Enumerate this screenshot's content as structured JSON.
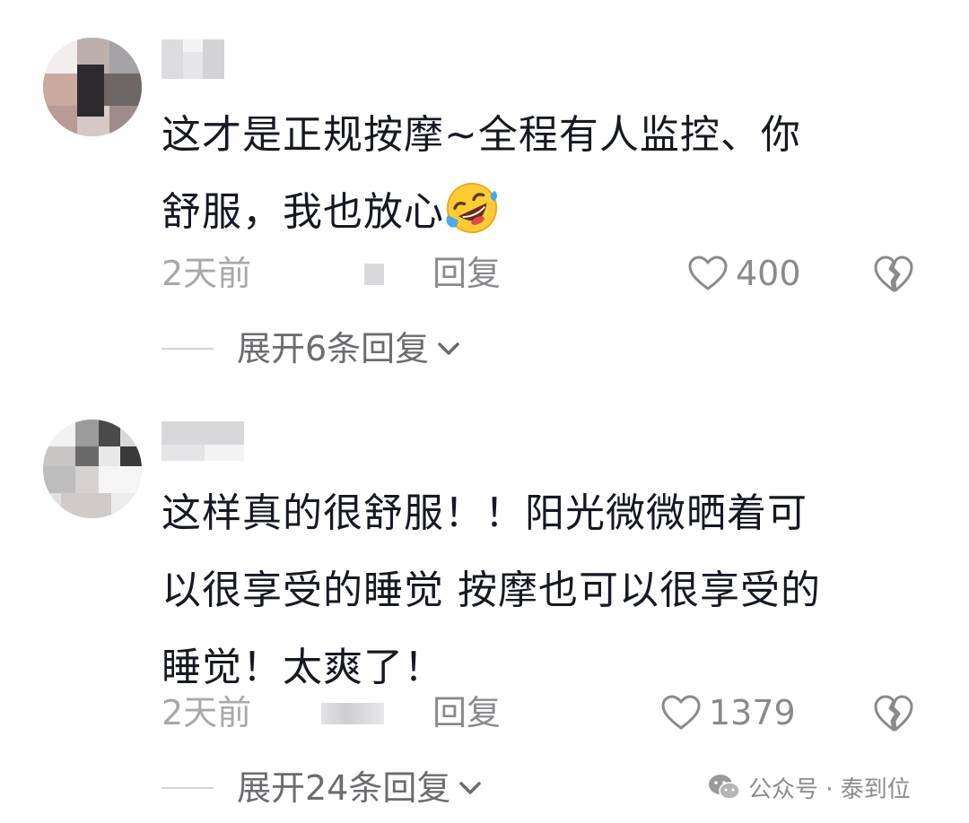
{
  "comments": [
    {
      "text_line1": "这才是正规按摩~全程有人监控、你",
      "text_line2": "舒服，我也放心",
      "emoji": "rolling-on-floor-laughing-icon",
      "time": "2天前",
      "reply_label": "回复",
      "likes": "400",
      "expand_label": "展开6条回复"
    },
    {
      "text_line1": "这样真的很舒服！！阳光微微晒着可",
      "text_line2": "以很享受的睡觉 按摩也可以很享受的",
      "text_line3": "睡觉！太爽了！",
      "time": "2天前",
      "reply_label": "回复",
      "likes": "1379",
      "expand_label": "展开24条回复"
    }
  ],
  "watermark": {
    "text": "公众号 · 泰到位"
  },
  "colors": {
    "text_primary": "#161823",
    "text_secondary": "#a8a8ab",
    "text_action": "#8a8a8e"
  }
}
